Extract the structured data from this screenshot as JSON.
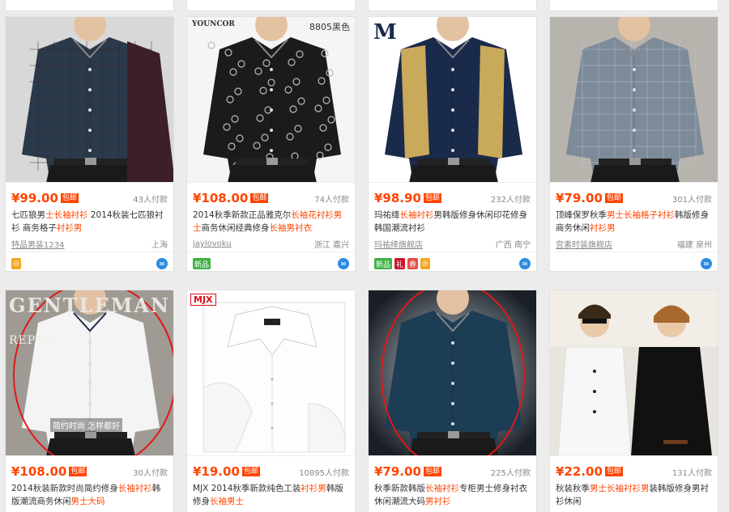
{
  "products": [
    {
      "price": "¥99.00",
      "badge": "包邮",
      "sold": "43人付款",
      "title_plain_1": "七匹狼男",
      "title_hl_1": "士长袖衬衫",
      "title_plain_2": " 2014秋装七匹狼衬衫 ",
      "title_plain_3": "商务格子",
      "title_hl_2": "衬衫男",
      "shop": "特品男装1234",
      "location": "上海",
      "icons": [
        {
          "name": "tmall-icon",
          "color": "#f5a623",
          "text": "◎"
        }
      ],
      "image_caption": "",
      "img": {
        "bg": "#d8d8d8",
        "shirt": "#2b3a4a",
        "accent": "#3c1f2b",
        "check": true
      }
    },
    {
      "price": "¥108.00",
      "badge": "包邮",
      "sold": "74人付款",
      "title_plain_1": "2014秋季新款正品雅克尔",
      "title_hl_1": "长袖花衬衫男士",
      "title_plain_2": "商务休闲经典修身",
      "title_plain_3": "",
      "title_hl_2": "长袖男衬衣",
      "shop": "jaylovoku",
      "location": "浙江 嘉兴",
      "icons": [
        {
          "name": "new-item-icon",
          "color": "#3fb244",
          "text": "新品"
        }
      ],
      "image_caption": "8805黑色",
      "brand": "YOUNCOR",
      "img": {
        "bg": "#f5f5f5",
        "shirt": "#1b1b1b",
        "accent": "#555",
        "check": false,
        "floral": true
      }
    },
    {
      "price": "¥98.90",
      "badge": "包邮",
      "sold": "232人付款",
      "title_plain_1": "玛祐绛",
      "title_hl_1": "长袖衬衫",
      "title_plain_2": "男韩版修身休闲印花修身韩国潮流衬衫",
      "title_plain_3": "",
      "title_hl_2": "",
      "shop": "玛祐绛旗舰店",
      "location": "广西 南宁",
      "icons": [
        {
          "name": "new-item-icon",
          "color": "#3fb244",
          "text": "新品"
        },
        {
          "name": "gift-icon",
          "color": "#c9152b",
          "text": "礼"
        },
        {
          "name": "coupon-icon",
          "color": "#e84c3d",
          "text": "券"
        },
        {
          "name": "tmall-icon",
          "color": "#f5a623",
          "text": "◎"
        }
      ],
      "image_caption": "",
      "brand": "M",
      "img": {
        "bg": "#ffffff",
        "shirt": "#1a2a4a",
        "accent": "#c9a95a",
        "check": false
      }
    },
    {
      "price": "¥79.00",
      "badge": "包邮",
      "sold": "301人付款",
      "title_plain_1": "顶峰保罗秋季",
      "title_hl_1": "男士长袖格子衬衫",
      "title_plain_2": "韩版修身商务休闲",
      "title_plain_3": "",
      "title_hl_2": "衬衫男",
      "shop": "宫素时装旗舰店",
      "location": "福建 泉州",
      "icons": [],
      "image_caption": "",
      "img": {
        "bg": "#b7b4ad",
        "shirt": "#7d8a9a",
        "accent": "#c4c8cf",
        "check": true
      }
    },
    {
      "price": "¥108.00",
      "badge": "包邮",
      "sold": "30人付款",
      "title_plain_1": "2014秋装新款时尚简约修身",
      "title_hl_1": "长袖衬衫",
      "title_plain_2": "韩版潮流商务休闲",
      "title_plain_3": "",
      "title_hl_2": "男士大码",
      "shop": "",
      "location": "",
      "icons": [],
      "image_caption": "GENTLEMAN",
      "image_caption_2": "REPAIR",
      "image_caption_3": "简约时尚 怎样都好",
      "img": {
        "bg": "#9f9a94",
        "shirt": "#f4f4f4",
        "accent": "#1d2b4a",
        "check": false,
        "circle": true
      }
    },
    {
      "price": "¥19.00",
      "badge": "包邮",
      "sold": "10895人付款",
      "title_plain_1": "MJX 2014秋季新款纯色工装",
      "title_hl_1": "衬衫男",
      "title_plain_2": "韩版修身",
      "title_plain_3": "",
      "title_hl_2": "长袖男士",
      "shop": "",
      "location": "",
      "icons": [],
      "image_caption": "MJX",
      "img": {
        "bg": "#ffffff",
        "shirt": "#ffffff",
        "accent": "#dddddd",
        "check": false,
        "folded": true
      }
    },
    {
      "price": "¥79.00",
      "badge": "包邮",
      "sold": "225人付款",
      "title_plain_1": "秋季新款韩版",
      "title_hl_1": "长袖衬衫",
      "title_plain_2": "专柜男士修身衬衣休闲潮流大码",
      "title_plain_3": "",
      "title_hl_2": "男衬衫",
      "shop": "",
      "location": "",
      "icons": [],
      "image_caption": "",
      "img": {
        "bg": "#1f2630",
        "shirt": "#1d3d55",
        "accent": "#2f5d78",
        "check": false,
        "circle": true
      }
    },
    {
      "price": "¥22.00",
      "badge": "包邮",
      "sold": "131人付款",
      "title_plain_1": "秋装秋季",
      "title_hl_1": "男士长袖衬衫男",
      "title_plain_2": "装韩版修身男衬衫休闲",
      "title_plain_3": "",
      "title_hl_2": "",
      "shop": "",
      "location": "",
      "icons": [],
      "image_caption": "",
      "img": {
        "bg": "#e8e4de",
        "shirt": "#f8f8f8",
        "accent": "#111111",
        "check": false,
        "pair": true
      }
    }
  ]
}
